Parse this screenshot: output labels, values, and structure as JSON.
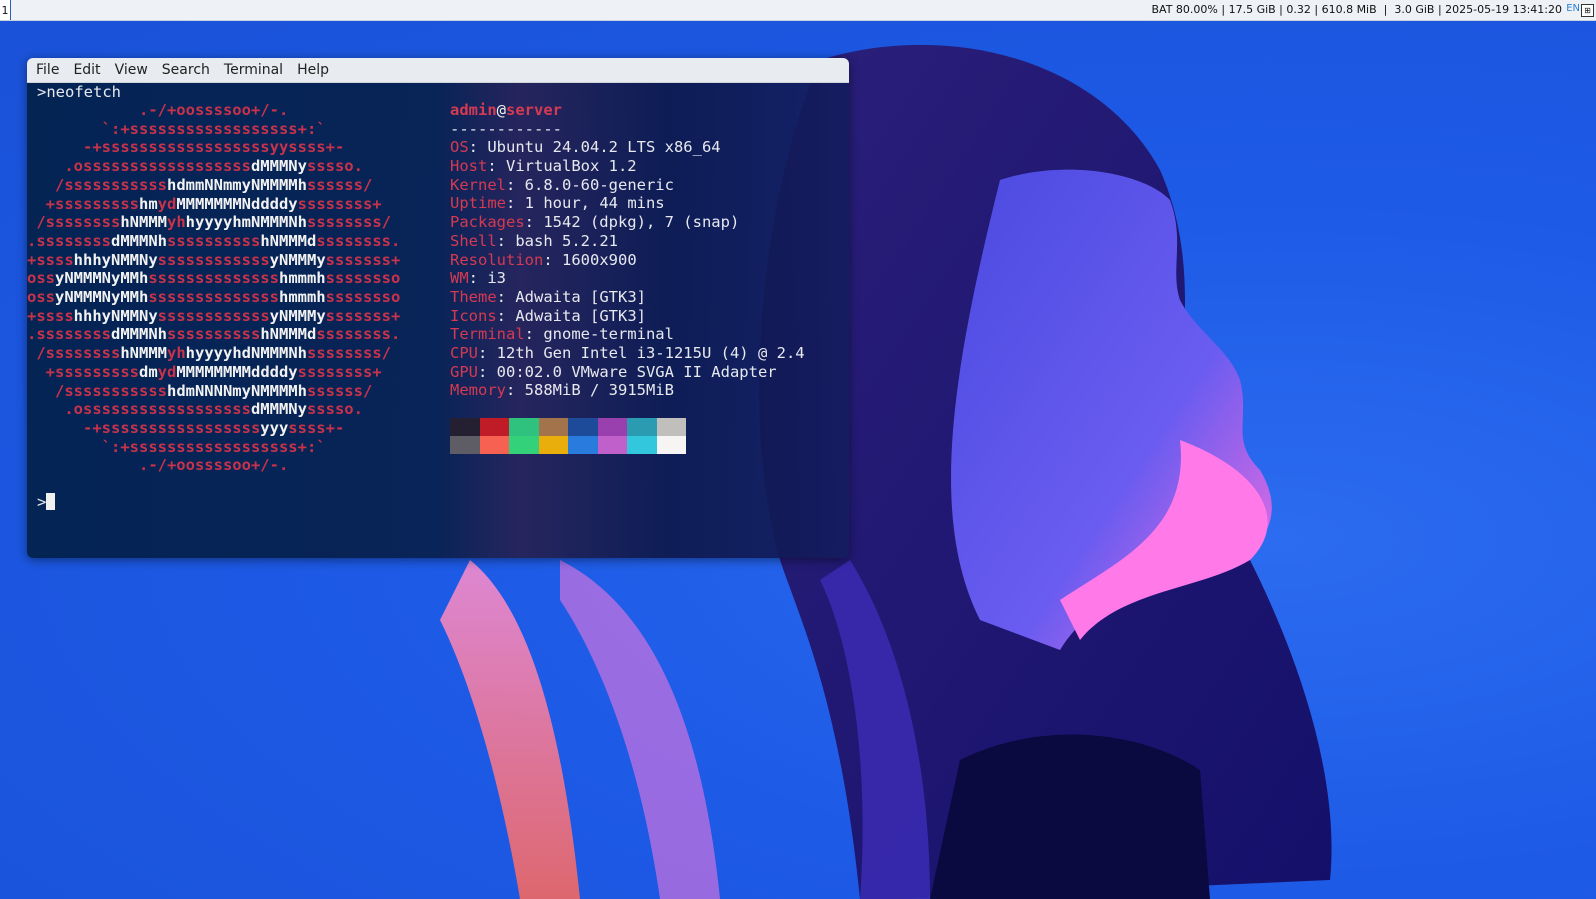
{
  "topbar": {
    "workspace": "1",
    "status": "BAT 80.00% | 17.5 GiB | 0.32 | 610.8 MiB  |  3.0 GiB | 2025-05-19 13:41:20",
    "language": "EN"
  },
  "menubar": {
    "items": [
      "File",
      "Edit",
      "View",
      "Search",
      "Terminal",
      "Help"
    ]
  },
  "terminal": {
    "command_line": ">neofetch",
    "prompt": ">",
    "logo_lines": [
      [
        [
          "r",
          "            .-/+oossssoo+/-.               "
        ]
      ],
      [
        [
          "r",
          "        `:+ssssssssssssssssss+:`           "
        ]
      ],
      [
        [
          "r",
          "      -+ssssssssssssssssssyyssss+-         "
        ]
      ],
      [
        [
          "r",
          "    .ossssssssssssssssss"
        ],
        [
          "w",
          "dMMMNy"
        ],
        [
          "r",
          "sssso.       "
        ]
      ],
      [
        [
          "r",
          "   /sssssssssss"
        ],
        [
          "w",
          "hdmmNNmmyNMMMMh"
        ],
        [
          "r",
          "ssssss/      "
        ]
      ],
      [
        [
          "r",
          "  +sssssssss"
        ],
        [
          "w",
          "hm"
        ],
        [
          "r",
          "yd"
        ],
        [
          "w",
          "MMMMMMMNddddy"
        ],
        [
          "r",
          "ssssssss+     "
        ]
      ],
      [
        [
          "r",
          " /ssssssss"
        ],
        [
          "w",
          "hNMMM"
        ],
        [
          "r",
          "yh"
        ],
        [
          "w",
          "hyyyyhmNMMMNh"
        ],
        [
          "r",
          "ssssssss/    "
        ]
      ],
      [
        [
          "r",
          ".ssssssss"
        ],
        [
          "w",
          "dMMMNh"
        ],
        [
          "r",
          "ssssssssss"
        ],
        [
          "w",
          "hNMMMd"
        ],
        [
          "r",
          "ssssssss.    "
        ]
      ],
      [
        [
          "r",
          "+ssss"
        ],
        [
          "w",
          "hhhyNMMNy"
        ],
        [
          "r",
          "ssssssssssss"
        ],
        [
          "w",
          "yNMMMy"
        ],
        [
          "r",
          "sssssss+    "
        ]
      ],
      [
        [
          "r",
          "oss"
        ],
        [
          "w",
          "yNMMMNyMMh"
        ],
        [
          "r",
          "ssssssssssssss"
        ],
        [
          "w",
          "hmmmh"
        ],
        [
          "r",
          "ssssssso    "
        ]
      ],
      [
        [
          "r",
          "oss"
        ],
        [
          "w",
          "yNMMMNyMMh"
        ],
        [
          "r",
          "ssssssssssssss"
        ],
        [
          "w",
          "hmmmh"
        ],
        [
          "r",
          "ssssssso    "
        ]
      ],
      [
        [
          "r",
          "+ssss"
        ],
        [
          "w",
          "hhhyNMMNy"
        ],
        [
          "r",
          "ssssssssssss"
        ],
        [
          "w",
          "yNMMMy"
        ],
        [
          "r",
          "sssssss+    "
        ]
      ],
      [
        [
          "r",
          ".ssssssss"
        ],
        [
          "w",
          "dMMMNh"
        ],
        [
          "r",
          "ssssssssss"
        ],
        [
          "w",
          "hNMMMd"
        ],
        [
          "r",
          "ssssssss.    "
        ]
      ],
      [
        [
          "r",
          " /ssssssss"
        ],
        [
          "w",
          "hNMMM"
        ],
        [
          "r",
          "yh"
        ],
        [
          "w",
          "hyyyyhdNMMMNh"
        ],
        [
          "r",
          "ssssssss/    "
        ]
      ],
      [
        [
          "r",
          "  +sssssssss"
        ],
        [
          "w",
          "dm"
        ],
        [
          "r",
          "yd"
        ],
        [
          "w",
          "MMMMMMMMddddy"
        ],
        [
          "r",
          "ssssssss+     "
        ]
      ],
      [
        [
          "r",
          "   /sssssssssss"
        ],
        [
          "w",
          "hdmNNNNmyNMMMMh"
        ],
        [
          "r",
          "ssssss/      "
        ]
      ],
      [
        [
          "r",
          "    .ossssssssssssssssss"
        ],
        [
          "w",
          "dMMMNy"
        ],
        [
          "r",
          "sssso.       "
        ]
      ],
      [
        [
          "r",
          "      -+sssssssssssssssss"
        ],
        [
          "w",
          "yyy"
        ],
        [
          "r",
          "ssss+-         "
        ]
      ],
      [
        [
          "r",
          "        `:+ssssssssssssssssss+:`           "
        ]
      ],
      [
        [
          "r",
          "            .-/+oossssoo+/-.               "
        ]
      ]
    ],
    "info": {
      "user": "admin",
      "at": "@",
      "host": "server",
      "separator": "------------",
      "fields": [
        {
          "key": "OS",
          "value": ": Ubuntu 24.04.2 LTS x86_64"
        },
        {
          "key": "Host",
          "value": ": VirtualBox 1.2"
        },
        {
          "key": "Kernel",
          "value": ": 6.8.0-60-generic"
        },
        {
          "key": "Uptime",
          "value": ": 1 hour, 44 mins"
        },
        {
          "key": "Packages",
          "value": ": 1542 (dpkg), 7 (snap)"
        },
        {
          "key": "Shell",
          "value": ": bash 5.2.21"
        },
        {
          "key": "Resolution",
          "value": ": 1600x900"
        },
        {
          "key": "WM",
          "value": ": i3"
        },
        {
          "key": "Theme",
          "value": ": Adwaita [GTK3]"
        },
        {
          "key": "Icons",
          "value": ": Adwaita [GTK3]"
        },
        {
          "key": "Terminal",
          "value": ": gnome-terminal"
        },
        {
          "key": "CPU",
          "value": ": 12th Gen Intel i3-1215U (4) @ 2.4"
        },
        {
          "key": "GPU",
          "value": ": 00:02.0 VMware SVGA II Adapter"
        },
        {
          "key": "Memory",
          "value": ": 588MiB / 3915MiB"
        }
      ]
    },
    "palette": {
      "normal": [
        "#241f31",
        "#c01c28",
        "#2ec27e",
        "#a3734c",
        "#1e4a9a",
        "#9a3fae",
        "#2a9bb0",
        "#c0bfbc"
      ],
      "bright": [
        "#5e5c64",
        "#f66151",
        "#33d17a",
        "#e9ad0c",
        "#2a7bde",
        "#c061cb",
        "#33c7de",
        "#f6f5f4"
      ]
    }
  }
}
